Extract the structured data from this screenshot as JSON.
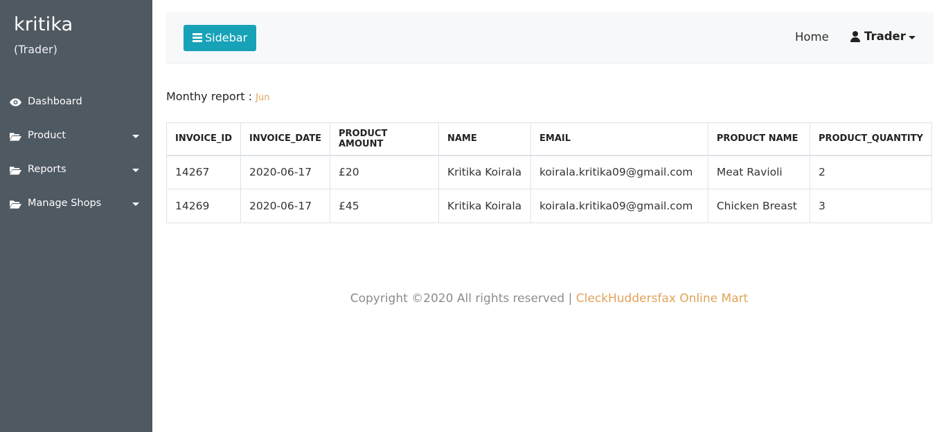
{
  "sidebar": {
    "username": "kritika",
    "role": "(Trader)",
    "items": [
      {
        "label": "Dashboard",
        "icon": "eye-icon",
        "dropdown": false
      },
      {
        "label": "Product",
        "icon": "folder-open-icon",
        "dropdown": true
      },
      {
        "label": "Reports",
        "icon": "folder-open-icon",
        "dropdown": true
      },
      {
        "label": "Manage Shops",
        "icon": "folder-open-icon",
        "dropdown": true
      }
    ]
  },
  "topbar": {
    "sidebar_button": "Sidebar",
    "home_link": "Home",
    "user_menu": "Trader"
  },
  "report": {
    "label": "Monthy report :",
    "month": "Jun"
  },
  "table": {
    "headers": [
      "INVOICE_ID",
      "INVOICE_DATE",
      "PRODUCT AMOUNT",
      "NAME",
      "EMAIL",
      "PRODUCT NAME",
      "PRODUCT_QUANTITY"
    ],
    "rows": [
      [
        "14267",
        "2020-06-17",
        "£20",
        "Kritika Koirala",
        "koirala.kritika09@gmail.com",
        "Meat Ravioli",
        "2"
      ],
      [
        "14269",
        "2020-06-17",
        "£45",
        "Kritika Koirala",
        "koirala.kritika09@gmail.com",
        "Chicken Breast",
        "3"
      ]
    ]
  },
  "footer": {
    "copyright": "Copyright ©2020 All rights reserved | ",
    "brand": "CleckHuddersfax Online Mart"
  },
  "colors": {
    "sidebar_bg": "#4f5962",
    "accent_button": "#17a2b8",
    "brand_orange": "#e0a35a"
  }
}
